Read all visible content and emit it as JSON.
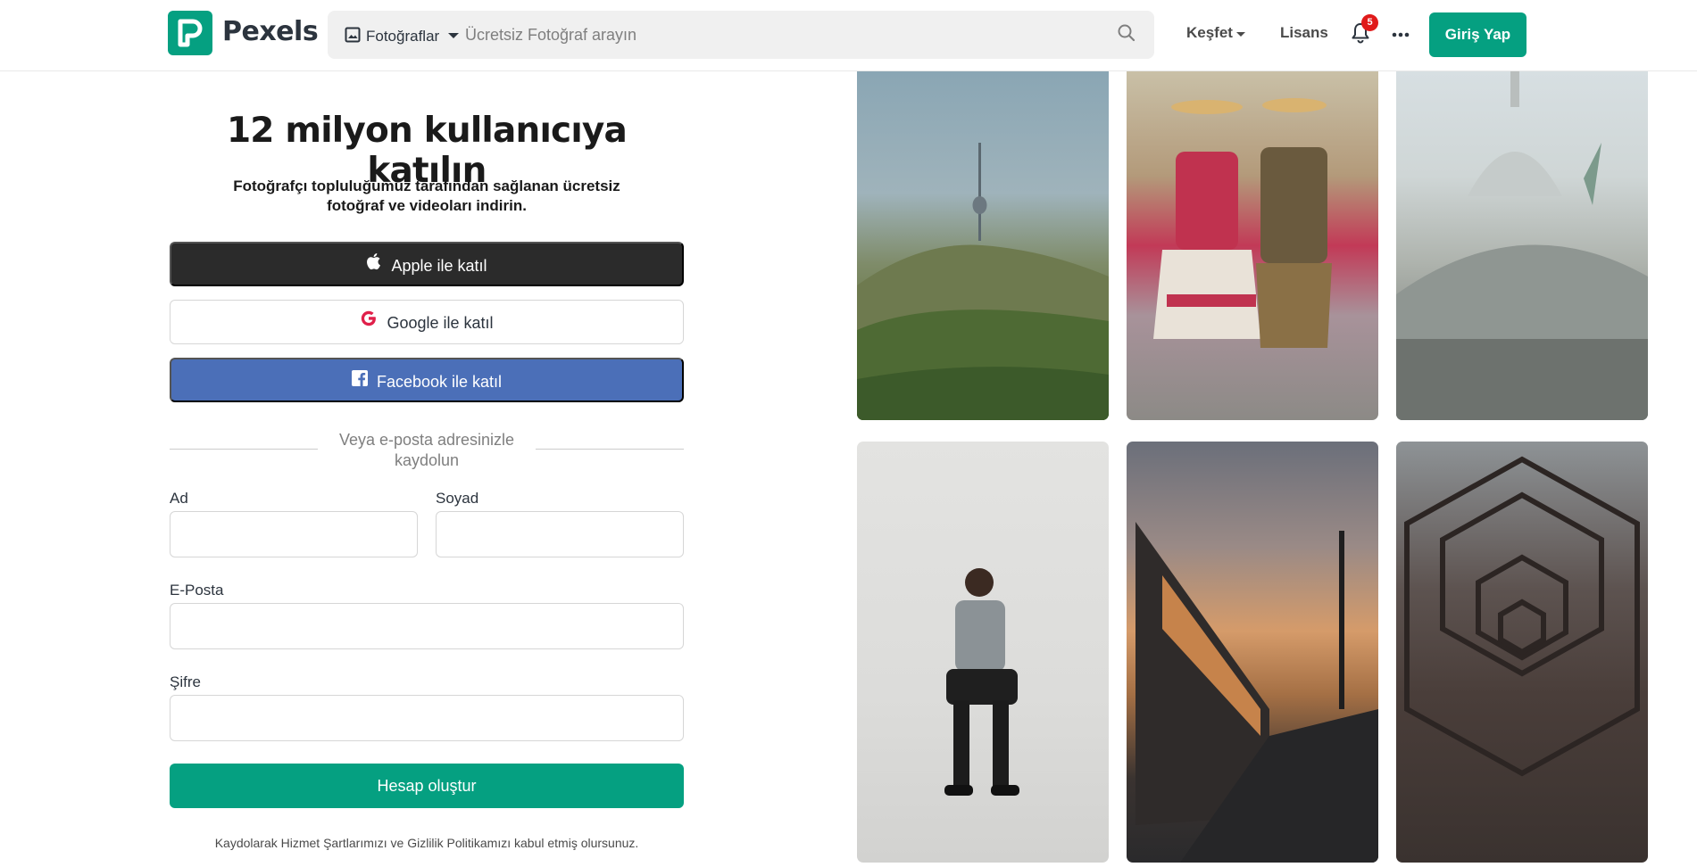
{
  "header": {
    "logo_text": "Pexels",
    "search_type_label": "Fotoğraflar",
    "search_placeholder": "Ücretsiz Fotoğraf arayın",
    "nav_explore": "Keşfet",
    "nav_license": "Lisans",
    "notification_count": "5",
    "login_label": "Giriş Yap"
  },
  "signup": {
    "title": "12 milyon kullanıcıya katılın",
    "subtitle": "Fotoğrafçı topluluğumuz tarafından sağlanan ücretsiz fotoğraf ve videoları indirin.",
    "apple_label": "Apple ile katıl",
    "google_label": "Google ile katıl",
    "facebook_label": "Facebook ile katıl",
    "divider_text": "Veya e-posta adresinizle kaydolun",
    "first_name_label": "Ad",
    "first_name_value": "",
    "last_name_label": "Soyad",
    "last_name_value": "",
    "email_label": "E-Posta",
    "email_value": "",
    "password_label": "Şifre",
    "password_value": "",
    "create_label": "Hesap oluştur",
    "terms_text": "Kaydolarak Hizmet Şartlarımızı ve Gizlilik Politikamızı kabul etmiş olursunuz."
  },
  "photos": [
    {
      "subject": "tv-tower-on-hill"
    },
    {
      "subject": "two-people-traditional-costumes"
    },
    {
      "subject": "domed-basilica-with-statue"
    },
    {
      "subject": "man-seated-on-stool"
    },
    {
      "subject": "train-at-sunset"
    },
    {
      "subject": "honeycomb-staircase-structure"
    }
  ],
  "colors": {
    "brand": "#05a081",
    "apple_button": "#2b2b2b",
    "facebook_button": "#4b6fb8",
    "notification_badge": "#e01a1a"
  }
}
